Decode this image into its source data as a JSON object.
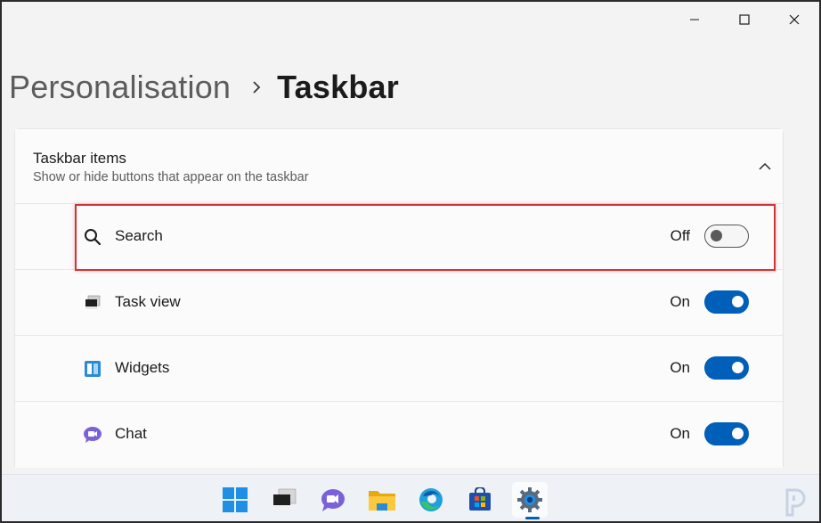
{
  "breadcrumb": {
    "parent": "Personalisation",
    "current": "Taskbar"
  },
  "section": {
    "title": "Taskbar items",
    "subtitle": "Show or hide buttons that appear on the taskbar",
    "expanded": true
  },
  "items": [
    {
      "label": "Search",
      "state": "Off",
      "enabled": false,
      "icon": "search-icon"
    },
    {
      "label": "Task view",
      "state": "On",
      "enabled": true,
      "icon": "task-view-icon"
    },
    {
      "label": "Widgets",
      "state": "On",
      "enabled": true,
      "icon": "widgets-icon"
    },
    {
      "label": "Chat",
      "state": "On",
      "enabled": true,
      "icon": "chat-icon"
    }
  ],
  "taskbar": {
    "apps": [
      "start-icon",
      "task-view-icon",
      "teams-chat-icon",
      "file-explorer-icon",
      "edge-icon",
      "store-icon",
      "settings-icon"
    ],
    "active": "settings-icon"
  },
  "colors": {
    "accent": "#005fb8",
    "highlight": "#d13438",
    "background": "#f3f3f3"
  }
}
